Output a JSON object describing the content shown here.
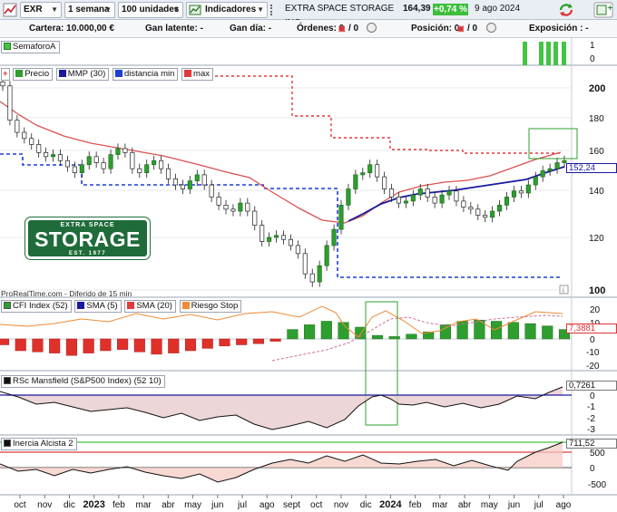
{
  "toolbar": {
    "ticker": "EXR",
    "period": "1 semana",
    "units": "100 unidades",
    "indicators": "Indicadores",
    "instrument": "EXTRA SPACE STORAGE INC",
    "price": "164,39",
    "change": "+0,74 %",
    "date": "9 ago 2024"
  },
  "infobar": {
    "cartera": "Cartera: 10.000,00 €",
    "gan_latente": "Gan latente: -",
    "gan_dia": "Gan día: -",
    "ordenes_label": "Órdenes: 0",
    "ordenes_sep": "/ 0",
    "posicion_label": "Posición: 0",
    "posicion_sep": "/ 0",
    "exposicion": "Exposición : -"
  },
  "semaforo": {
    "label": "SemaforoA",
    "axis_top": "1",
    "axis_zero": "0"
  },
  "price_panel": {
    "legend": [
      "Precio",
      "MMP (30)",
      "distancia min",
      "max"
    ],
    "y_ticks": [
      "200",
      "180",
      "160",
      "140",
      "120",
      "100"
    ],
    "last_ma": "152,24",
    "source": "ProRealTime.com - Diferido de 15 min",
    "logo": {
      "top": "EXTRA SPACE",
      "main": "STORAGE",
      "bottom": "EST. 1977"
    }
  },
  "cfi_panel": {
    "legend": [
      "CFI Index (52)",
      "SMA (5)",
      "SMA (20)",
      "Riesgo Stop"
    ],
    "y_ticks": [
      "20",
      "10",
      "0",
      "-10",
      "-20"
    ],
    "last": "7,3881"
  },
  "rsc_panel": {
    "legend": "RSc Mansfield (S&P500 Index) (52 10)",
    "y_ticks": [
      "0",
      "-1",
      "-2",
      "-3"
    ],
    "last": "0,7261"
  },
  "inercia_panel": {
    "legend": "Inercia Alcista 2",
    "y_ticks": [
      "500",
      "0",
      "-500"
    ],
    "last": "711,52"
  },
  "x_axis": {
    "labels": [
      "oct",
      "nov",
      "dic",
      "2023",
      "feb",
      "mar",
      "abr",
      "may",
      "jun",
      "jul",
      "ago",
      "sept",
      "oct",
      "nov",
      "dic",
      "2024",
      "feb",
      "mar",
      "abr",
      "may",
      "jun",
      "jul",
      "ago"
    ]
  },
  "colors": {
    "bull": "#2e9e2e",
    "bear": "#e0302a",
    "ma30": "#d9534f",
    "trend_ma": "#1a1aa0",
    "dist_min": "#1f3fd1",
    "max_line": "#e23a3a",
    "accent_green": "#43c443",
    "logo_green": "#1f6b3a"
  },
  "chart_data": [
    {
      "type": "candlestick",
      "title": "EXR",
      "series": [
        {
          "name": "Precio",
          "values": [
            201,
            184,
            178,
            175,
            172,
            168,
            166,
            167,
            164,
            161,
            158,
            162,
            166,
            163,
            160,
            167,
            170,
            168,
            160,
            158,
            162,
            164,
            160,
            155,
            152,
            150,
            154,
            157,
            152,
            146,
            142,
            140,
            139,
            143,
            139,
            132,
            124,
            126,
            127,
            125,
            122,
            118,
            108,
            104,
            112,
            122,
            130,
            142,
            150,
            157,
            158,
            162,
            156,
            150,
            146,
            143,
            144,
            147,
            150,
            146,
            143,
            147,
            149,
            144,
            141,
            140,
            137,
            136,
            139,
            142,
            146,
            149,
            148,
            152,
            156,
            159,
            160,
            163,
            164
          ]
        },
        {
          "name": "MMP (30)",
          "values": [
            190,
            172,
            164,
            160,
            158,
            158,
            156,
            154,
            148,
            142,
            130,
            122,
            126,
            134,
            140,
            143,
            144,
            145,
            147,
            150,
            155
          ]
        },
        {
          "name": "distancia min",
          "values": [
            160,
            160,
            156,
            156,
            143,
            143,
            143,
            143,
            143,
            142,
            142,
            104,
            104,
            104,
            104,
            104,
            104,
            104,
            104,
            104,
            104
          ]
        },
        {
          "name": "max",
          "values": [
            204,
            204,
            204,
            204,
            204,
            204,
            204,
            204,
            204,
            168,
            168,
            168,
            168,
            168,
            160,
            160,
            160,
            160,
            160,
            160,
            160
          ]
        }
      ],
      "ylim": [
        96,
        210
      ]
    },
    {
      "type": "bar",
      "title": "CFI Index (52)",
      "series": [
        {
          "name": "CFI Index (52)",
          "values": [
            -5,
            -10,
            -11,
            -12,
            -14,
            -12,
            -10,
            -9,
            -11,
            -13,
            -12,
            -10,
            -8,
            -6,
            -5,
            -4,
            -2,
            8,
            12,
            15,
            14,
            10,
            3,
            2,
            4,
            6,
            12,
            15,
            16,
            15,
            14,
            13,
            11,
            8
          ]
        },
        {
          "name": "SMA (5)",
          "values": [
            5,
            12,
            18,
            10,
            8,
            6,
            3,
            4,
            2,
            6,
            10,
            14,
            8,
            2,
            3,
            10,
            18,
            12,
            6,
            8,
            10,
            12,
            9,
            7
          ]
        },
        {
          "name": "SMA (20)",
          "values": [
            -12,
            -12,
            -11,
            -10,
            -9,
            -8,
            -6,
            -3,
            2,
            6,
            9,
            10,
            11,
            12,
            12,
            13
          ]
        }
      ],
      "ylim": [
        -23,
        23
      ]
    },
    {
      "type": "line",
      "title": "RSc Mansfield (S&P500 Index) (52 10)",
      "series": [
        {
          "name": "RSc Mansfield (S&P500 Index) (52 10)",
          "values": [
            0.2,
            -0.5,
            -1.2,
            -1.0,
            -1.3,
            -1.6,
            -1.4,
            -1.3,
            -1.7,
            -2.0,
            -1.6,
            -2.2,
            -3.0,
            -2.6,
            -2.1,
            -1.5,
            -0.7,
            0.0,
            -0.8,
            -1.6,
            -1.3,
            -1.1,
            -0.6,
            -1.0,
            -0.8,
            -0.3,
            0.0,
            0.2,
            0.7
          ]
        }
      ],
      "ylim": [
        -3.5,
        1
      ]
    },
    {
      "type": "area",
      "title": "Inercia Alcista 2",
      "series": [
        {
          "name": "Inercia Alcista 2",
          "values": [
            -200,
            -300,
            -250,
            -450,
            -300,
            -400,
            -300,
            -250,
            -350,
            -450,
            -500,
            -400,
            -600,
            -500,
            -300,
            -100,
            50,
            150,
            100,
            200,
            0,
            100,
            300,
            250,
            0,
            -50,
            150,
            400,
            600,
            700
          ]
        }
      ],
      "ylim": [
        -800,
        800
      ]
    }
  ]
}
